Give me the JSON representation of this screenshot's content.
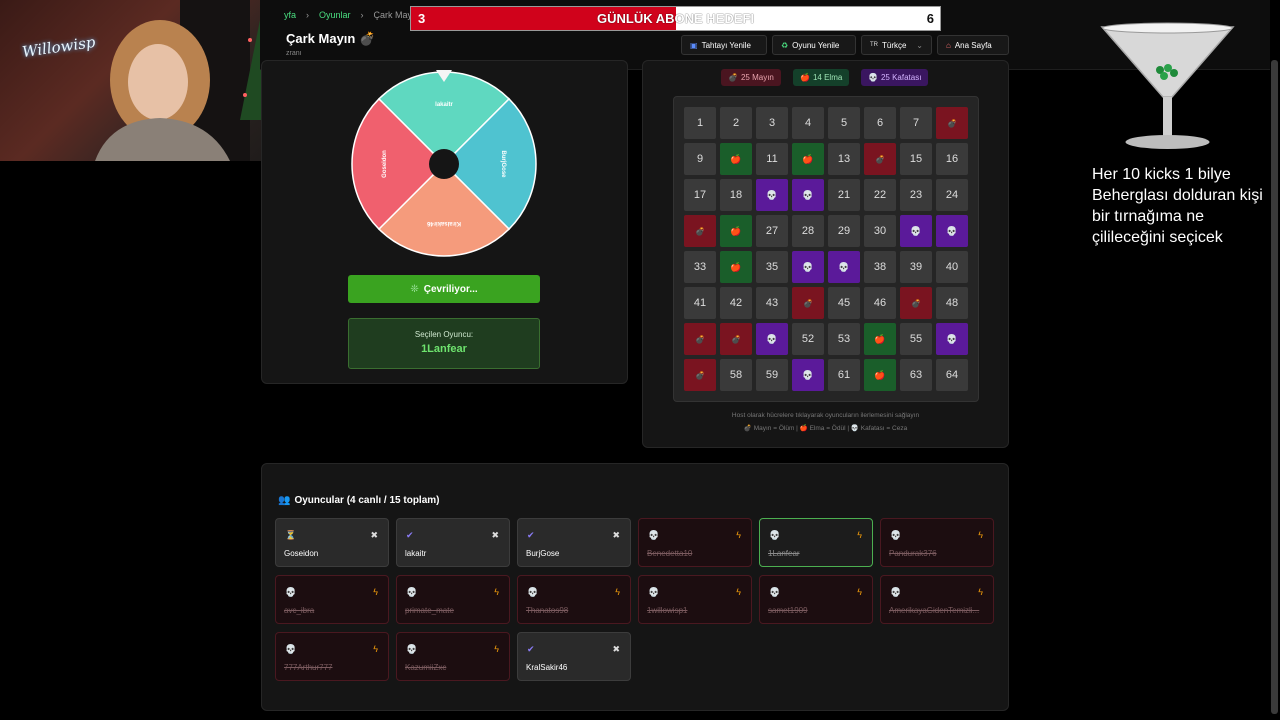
{
  "breadcrumb": {
    "home": "yfa",
    "games": "Oyunlar",
    "current": "Çark Mayın"
  },
  "header": {
    "title": "Çark Mayın",
    "title_icon": "bomb-icon",
    "subtitle": "zranı"
  },
  "top_buttons": {
    "refresh_board": "Tahtayı Yenile",
    "new_game": "Oyunu Yenile",
    "language": "Türkçe",
    "language_flag": "TR",
    "home": "Ana Sayfa"
  },
  "goal": {
    "title": "GÜNLÜK ABONE HEDEFI",
    "current": "3",
    "target": "6",
    "progress": 0.5,
    "fill_color": "#d0021b"
  },
  "webcam": {
    "neon_sign": "Willowisp"
  },
  "wheel": {
    "segments": [
      {
        "label": "lakaitr",
        "color": "#5fd8c0"
      },
      {
        "label": "BurjGose",
        "color": "#4fc3d0"
      },
      {
        "label": "Kiralsakir46",
        "color": "#f59b7c"
      },
      {
        "label": "Goseidon",
        "color": "#f0606e"
      }
    ],
    "spin_button": "Çevriliyor...",
    "selected_label": "Seçilen Oyuncu:",
    "selected_name": "1Lanfear"
  },
  "legend": {
    "mines": "25 Mayın",
    "apples": "14 Elma",
    "skulls": "25 Kafatası"
  },
  "board": {
    "cells": [
      "1",
      "2",
      "3",
      "4",
      "5",
      "6",
      "7",
      "M",
      "9",
      "A",
      "11",
      "A",
      "13",
      "M",
      "15",
      "16",
      "17",
      "18",
      "S",
      "S",
      "21",
      "22",
      "23",
      "24",
      "M",
      "A",
      "27",
      "28",
      "29",
      "30",
      "S",
      "S",
      "33",
      "A",
      "35",
      "S",
      "S",
      "38",
      "39",
      "40",
      "41",
      "42",
      "43",
      "M",
      "45",
      "46",
      "M",
      "48",
      "M",
      "M",
      "S",
      "52",
      "53",
      "A",
      "55",
      "S",
      "M",
      "58",
      "59",
      "S",
      "61",
      "A",
      "63",
      "64"
    ],
    "help_line1": "Host olarak hücrelere tıklayarak oyuncuların ilerlemesini sağlayın",
    "help_mine": "Mayın = Ölüm",
    "help_apple": "Elma = Ödül",
    "help_skull": "Kafatası = Ceza"
  },
  "players": {
    "title": "Oyuncular (4 canlı / 15 toplam)",
    "list": [
      {
        "name": "Goseidon",
        "status": "waiting"
      },
      {
        "name": "lakaitr",
        "status": "alive"
      },
      {
        "name": "BurjGose",
        "status": "alive"
      },
      {
        "name": "Benedetta10",
        "status": "dead"
      },
      {
        "name": "1Lanfear",
        "status": "selected"
      },
      {
        "name": "Pandurak376",
        "status": "dead"
      },
      {
        "name": "avc_ibra",
        "status": "dead"
      },
      {
        "name": "primate_mate",
        "status": "dead"
      },
      {
        "name": "Thanatos98",
        "status": "dead"
      },
      {
        "name": "1willowisp1",
        "status": "dead"
      },
      {
        "name": "samet1909",
        "status": "dead"
      },
      {
        "name": "AmerikayaGidenTemizli...",
        "status": "dead"
      },
      {
        "name": "777Arthur777",
        "status": "dead"
      },
      {
        "name": "KazumiiZxc",
        "status": "dead"
      },
      {
        "name": "KralSakir46",
        "status": "alive"
      }
    ]
  },
  "overlay": {
    "text": "Her 10 kicks 1 bilye Beherglası dolduran kişi bir tırnağıma ne çilileceğini seçicek"
  }
}
